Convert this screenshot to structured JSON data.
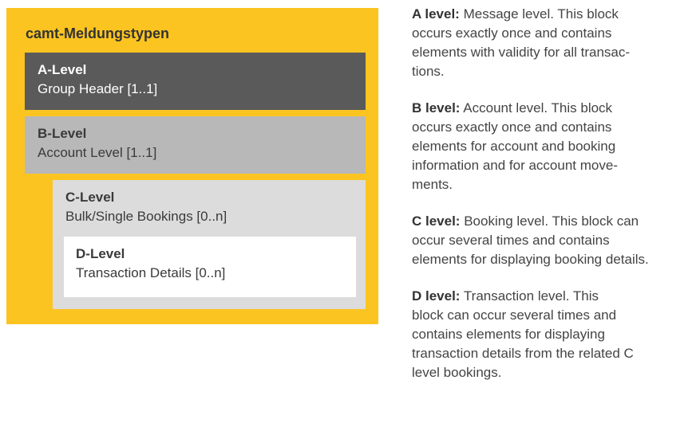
{
  "diagram": {
    "title": "camt-Meldungstypen",
    "levels": [
      {
        "name": "A-Level",
        "detail": "Group Header [1..1]",
        "color": "#5a5a5a"
      },
      {
        "name": "B-Level",
        "detail": "Account Level [1..1]",
        "color": "#b8b8b8"
      },
      {
        "name": "C-Level",
        "detail": "Bulk/Single Bookings [0..n]",
        "color": "#dcdcdc"
      },
      {
        "name": "D-Level",
        "detail": "Transaction Details [0..n]",
        "color": "#ffffff"
      }
    ],
    "background_color": "#fcc421"
  },
  "descriptions": [
    {
      "term": "A level:",
      "lines": [
        "Message level. This block",
        "occurs exactly once and contains",
        "elements with validity for all transac-",
        "tions."
      ]
    },
    {
      "term": "B level:",
      "lines": [
        "Account level. This block",
        "occurs exactly once and contains",
        "elements for account and booking",
        "information and for account move-",
        "ments."
      ]
    },
    {
      "term": "C level:",
      "lines": [
        "Booking level. This block can",
        "occur several times and contains",
        "elements for displaying booking details."
      ]
    },
    {
      "term": "D level:",
      "lines": [
        "Transaction level. This",
        "block can occur several times and",
        "contains elements for displaying",
        "transaction details from the related C",
        "level bookings."
      ]
    }
  ]
}
